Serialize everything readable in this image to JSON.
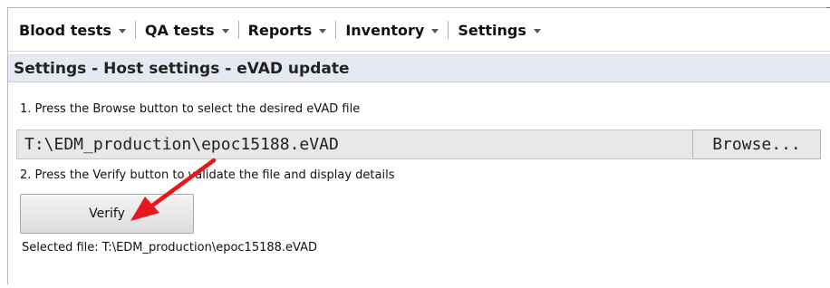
{
  "menu": {
    "items": [
      {
        "label": "Blood tests",
        "icon": "chevron-down-icon"
      },
      {
        "label": "QA tests",
        "icon": "chevron-down-icon"
      },
      {
        "label": "Reports",
        "icon": "chevron-down-icon"
      },
      {
        "label": "Inventory",
        "icon": "chevron-down-icon"
      },
      {
        "label": "Settings",
        "icon": "chevron-down-icon"
      }
    ]
  },
  "header": {
    "title": "Settings - Host settings - eVAD update"
  },
  "step1": {
    "instruction": "1. Press the Browse button to select the desired eVAD file",
    "file_path": "T:\\EDM_production\\epoc15188.eVAD",
    "browse_label": "Browse..."
  },
  "step2": {
    "instruction": "2. Press the Verify button to validate the file and display details",
    "verify_label": "Verify"
  },
  "selected_file": "Selected file: T:\\EDM_production\\epoc15188.eVAD",
  "annotation": {
    "arrow_color": "#e8171b",
    "icon": "red-arrow-icon"
  }
}
